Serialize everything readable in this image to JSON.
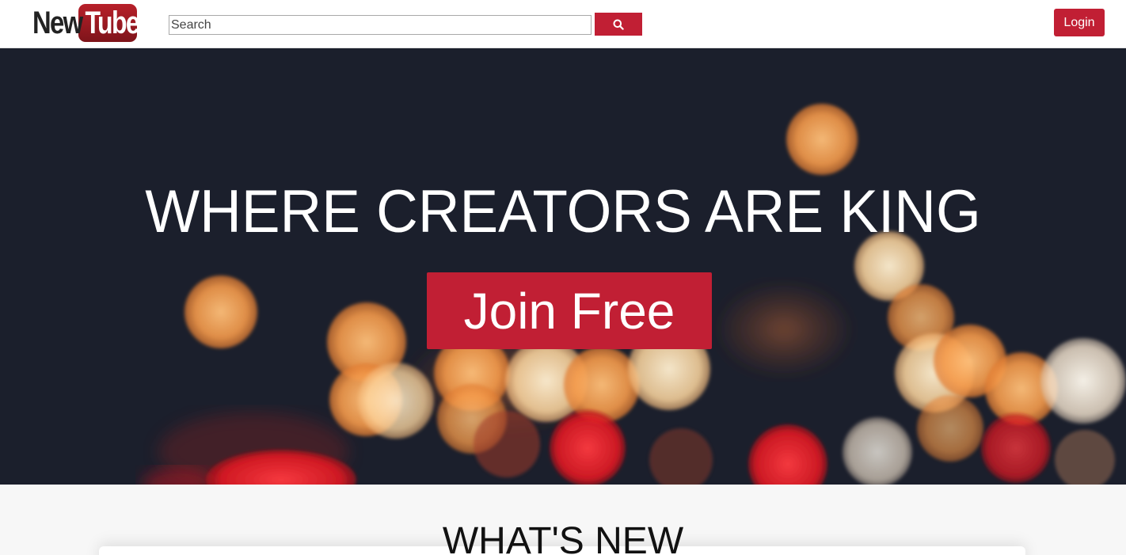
{
  "header": {
    "logo": {
      "part1": "New",
      "part2": "Tube"
    },
    "search": {
      "placeholder": "Search"
    },
    "login_label": "Login"
  },
  "hero": {
    "title": "WHERE CREATORS ARE KING",
    "cta_label": "Join Free"
  },
  "section": {
    "title": "WHAT'S NEW"
  },
  "colors": {
    "accent": "#c11f34",
    "hero_background": "#1b1f2c"
  },
  "icons": {
    "search": "search-icon"
  }
}
